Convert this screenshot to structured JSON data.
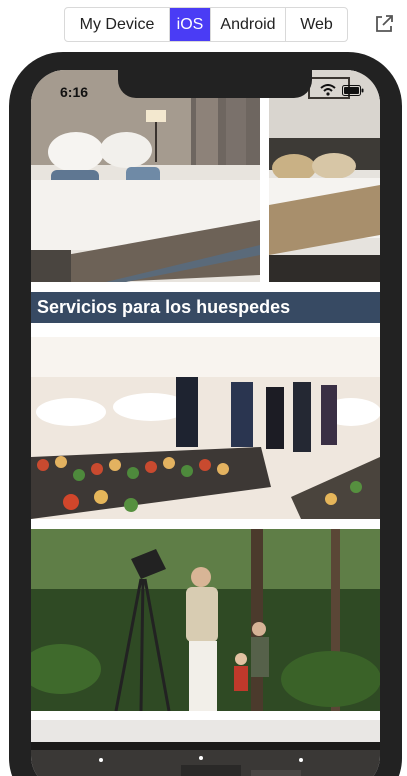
{
  "toggle": {
    "options": [
      "My Device",
      "iOS",
      "Android",
      "Web"
    ],
    "selected": "iOS"
  },
  "icons": {
    "external": "external-link-icon",
    "wifi": "wifi-icon",
    "battery": "battery-icon"
  },
  "colors": {
    "accent": "#4a3cf5",
    "section_header_bg": "#374a63",
    "phone_frame": "#222222"
  },
  "status_bar": {
    "time": "6:16"
  },
  "content": {
    "section_title": "Servicios para los huespedes",
    "images": [
      "hotel-room-1",
      "hotel-room-2",
      "event-catering",
      "birdwatching-tour",
      "gym"
    ]
  }
}
